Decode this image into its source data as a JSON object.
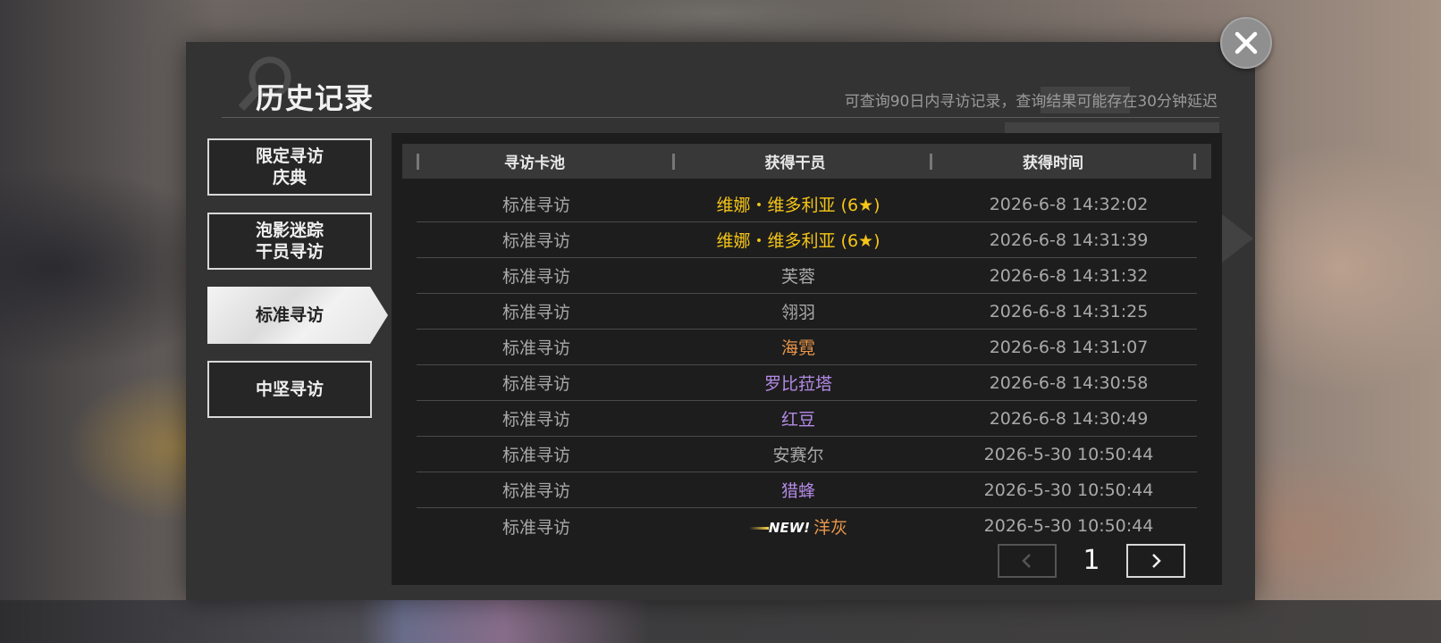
{
  "dialog": {
    "title": "历史记录",
    "subtitle": "可查询90日内寻访记录，查询结果可能存在30分钟延迟"
  },
  "tabs": [
    {
      "label": "限定寻访\n庆典",
      "active": false
    },
    {
      "label": "泡影迷踪\n干员寻访",
      "active": false
    },
    {
      "label": "标准寻访",
      "active": true
    },
    {
      "label": "中坚寻访",
      "active": false
    }
  ],
  "table": {
    "headers": [
      "寻访卡池",
      "获得干员",
      "获得时间"
    ],
    "rows": [
      {
        "pool": "标准寻访",
        "operator": "维娜・维多利亚 (6★)",
        "time": "2026-6-8 14:32:02",
        "color": "#f5c518",
        "new": ""
      },
      {
        "pool": "标准寻访",
        "operator": "维娜・维多利亚 (6★)",
        "time": "2026-6-8 14:31:39",
        "color": "#f5c518",
        "new": ""
      },
      {
        "pool": "标准寻访",
        "operator": "芙蓉",
        "time": "2026-6-8 14:31:32",
        "color": "#a9a9a9",
        "new": ""
      },
      {
        "pool": "标准寻访",
        "operator": "翎羽",
        "time": "2026-6-8 14:31:25",
        "color": "#a9a9a9",
        "new": ""
      },
      {
        "pool": "标准寻访",
        "operator": "海霓",
        "time": "2026-6-8 14:31:07",
        "color": "#e8954a",
        "new": ""
      },
      {
        "pool": "标准寻访",
        "operator": "罗比菈塔",
        "time": "2026-6-8 14:30:58",
        "color": "#b48ae6",
        "new": ""
      },
      {
        "pool": "标准寻访",
        "operator": "红豆",
        "time": "2026-6-8 14:30:49",
        "color": "#b48ae6",
        "new": ""
      },
      {
        "pool": "标准寻访",
        "operator": "安赛尔",
        "time": "2026-5-30 10:50:44",
        "color": "#a9a9a9",
        "new": ""
      },
      {
        "pool": "标准寻访",
        "operator": "猎蜂",
        "time": "2026-5-30 10:50:44",
        "color": "#b48ae6",
        "new": ""
      },
      {
        "pool": "标准寻访",
        "operator": "洋灰",
        "time": "2026-5-30 10:50:44",
        "color": "#e8954a",
        "new": "NEW!"
      }
    ]
  },
  "pager": {
    "page": "1",
    "prev_icon": "chevron-left-icon",
    "next_icon": "chevron-right-icon"
  },
  "close_icon": "close-icon"
}
